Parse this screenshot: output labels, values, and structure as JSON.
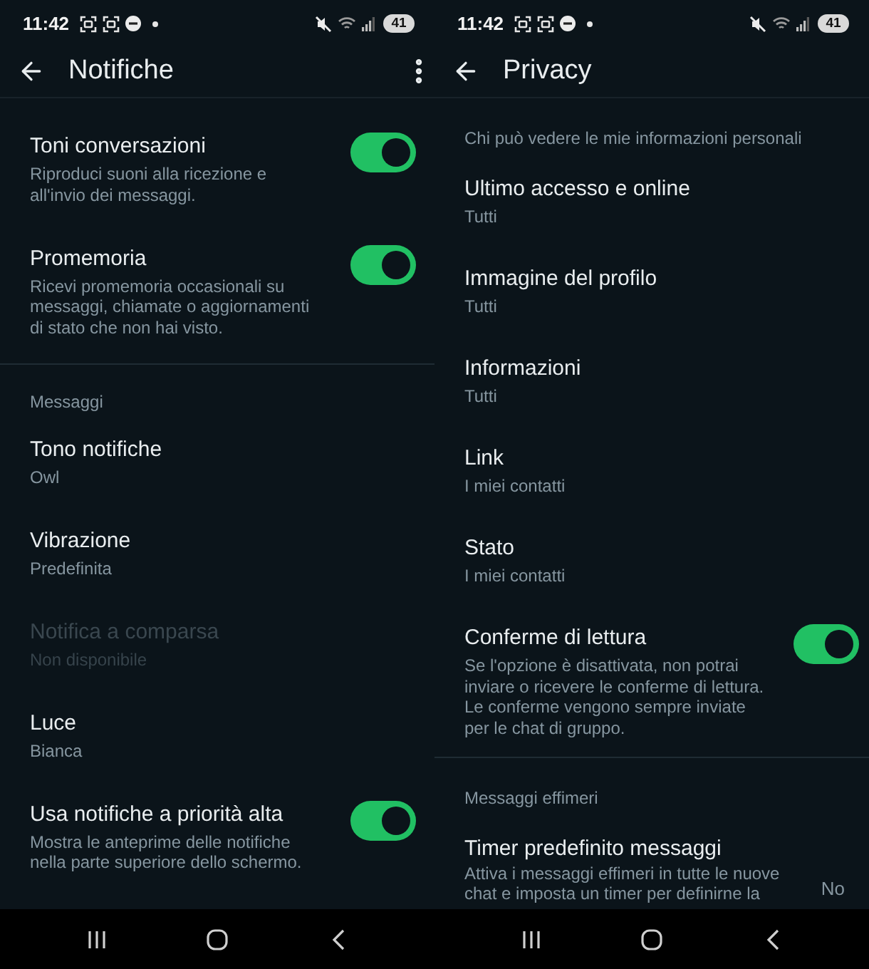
{
  "screens": [
    {
      "status_bar": {
        "time": "11:42",
        "battery": "41"
      },
      "title": "Notifiche",
      "overflow_menu": true,
      "sections": [
        {
          "items": [
            {
              "kind": "toggle",
              "title": "Toni conversazioni",
              "subtitle": "Riproduci suoni alla ricezione e all'invio dei messaggi.",
              "on": true,
              "disabled": false
            },
            {
              "kind": "toggle",
              "title": "Promemoria",
              "subtitle": "Ricevi promemoria occasionali su messaggi, chiamate o aggiornamenti di stato che non hai visto.",
              "on": true,
              "disabled": false
            }
          ]
        },
        {
          "header": "Messaggi",
          "items": [
            {
              "kind": "value",
              "title": "Tono notifiche",
              "value": "Owl",
              "disabled": false
            },
            {
              "kind": "value",
              "title": "Vibrazione",
              "value": "Predefinita",
              "disabled": false
            },
            {
              "kind": "value",
              "title": "Notifica a comparsa",
              "value": "Non disponibile",
              "disabled": true
            },
            {
              "kind": "value",
              "title": "Luce",
              "value": "Bianca",
              "disabled": false
            },
            {
              "kind": "toggle",
              "title": "Usa notifiche a priorità alta",
              "subtitle": "Mostra le anteprime delle notifiche nella parte superiore dello schermo.",
              "on": true,
              "disabled": false
            }
          ]
        }
      ]
    },
    {
      "status_bar": {
        "time": "11:42",
        "battery": "41"
      },
      "title": "Privacy",
      "overflow_menu": false,
      "sections": [
        {
          "header": "Chi può vedere le mie informazioni personali",
          "items": [
            {
              "kind": "value",
              "title": "Ultimo accesso e online",
              "value": "Tutti",
              "disabled": false
            },
            {
              "kind": "value",
              "title": "Immagine del profilo",
              "value": "Tutti",
              "disabled": false
            },
            {
              "kind": "value",
              "title": "Informazioni",
              "value": "Tutti",
              "disabled": false
            },
            {
              "kind": "value",
              "title": "Link",
              "value": "I miei contatti",
              "disabled": false
            },
            {
              "kind": "value",
              "title": "Stato",
              "value": "I miei contatti",
              "disabled": false
            },
            {
              "kind": "toggle",
              "title": "Conferme di lettura",
              "subtitle": "Se l'opzione è disattivata, non potrai inviare o ricevere le conferme di lettura. Le conferme vengono sempre inviate per le chat di gruppo.",
              "on": true,
              "disabled": false
            }
          ]
        },
        {
          "header": "Messaggi effimeri",
          "items": [
            {
              "kind": "detail",
              "title": "Timer predefinito messaggi",
              "subtitle": "Attiva i messaggi effimeri in tutte le nuove chat e imposta un timer per definirne la",
              "value": "No",
              "disabled": false
            }
          ]
        }
      ]
    }
  ]
}
